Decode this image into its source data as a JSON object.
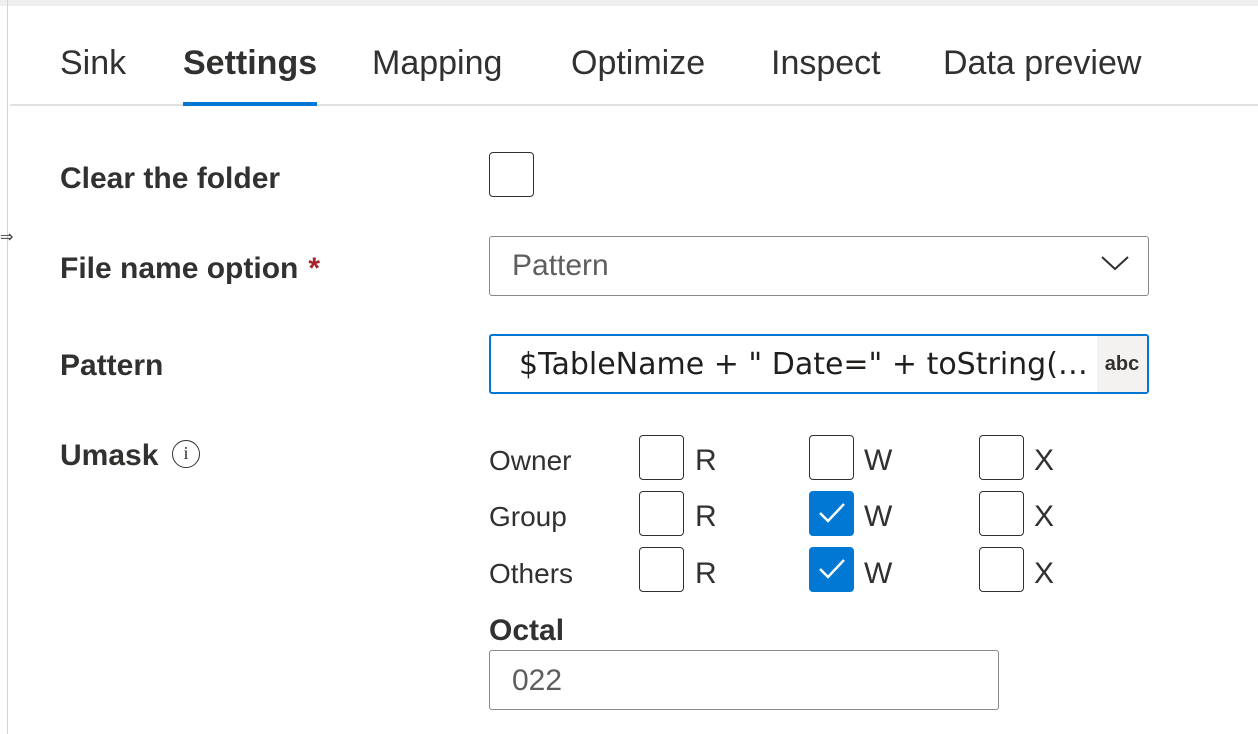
{
  "tabs": [
    {
      "label": "Sink"
    },
    {
      "label": "Settings",
      "active": true
    },
    {
      "label": "Mapping"
    },
    {
      "label": "Optimize"
    },
    {
      "label": "Inspect"
    },
    {
      "label": "Data preview"
    }
  ],
  "clear_folder": {
    "label": "Clear the folder",
    "checked": false
  },
  "file_name_option": {
    "label": "File name option",
    "required_marker": "*",
    "value": "Pattern"
  },
  "pattern": {
    "label": "Pattern",
    "value": "$TableName + \" Date=\" + toString($...",
    "type_badge": "abc"
  },
  "umask": {
    "label": "Umask",
    "info_icon": "info-icon",
    "rows": [
      {
        "name": "Owner",
        "R": false,
        "W": false,
        "X": false
      },
      {
        "name": "Group",
        "R": false,
        "W": true,
        "X": false
      },
      {
        "name": "Others",
        "R": false,
        "W": true,
        "X": false
      }
    ],
    "letters": {
      "R": "R",
      "W": "W",
      "X": "X"
    }
  },
  "octal": {
    "label": "Octal",
    "value": "022"
  },
  "colors": {
    "accent": "#0078d4",
    "required": "#a4262c"
  }
}
